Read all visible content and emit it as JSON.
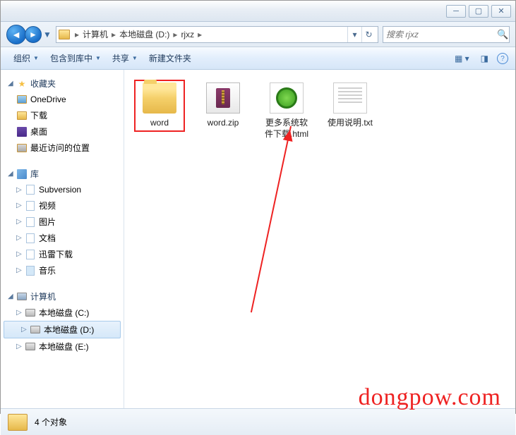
{
  "window": {
    "min_tip": "最小化",
    "max_tip": "最大化",
    "close_tip": "关闭"
  },
  "nav": {
    "breadcrumb": [
      "计算机",
      "本地磁盘 (D:)",
      "rjxz"
    ],
    "search_placeholder": "搜索 rjxz"
  },
  "toolbar": {
    "organize": "组织",
    "include": "包含到库中",
    "share": "共享",
    "newfolder": "新建文件夹"
  },
  "sidebar": {
    "favorites": {
      "label": "收藏夹",
      "items": [
        "OneDrive",
        "下载",
        "桌面",
        "最近访问的位置"
      ]
    },
    "libraries": {
      "label": "库",
      "items": [
        "Subversion",
        "视频",
        "图片",
        "文档",
        "迅雷下载",
        "音乐"
      ]
    },
    "computer": {
      "label": "计算机",
      "items": [
        "本地磁盘 (C:)",
        "本地磁盘 (D:)",
        "本地磁盘 (E:)"
      ]
    }
  },
  "files": [
    {
      "name": "word",
      "type": "folder",
      "highlighted": true
    },
    {
      "name": "word.zip",
      "type": "zip"
    },
    {
      "name": "更多系统软件下载.html",
      "type": "html"
    },
    {
      "name": "使用说明.txt",
      "type": "txt"
    }
  ],
  "status": {
    "count_text": "4 个对象"
  },
  "watermark": "dongpow.com"
}
